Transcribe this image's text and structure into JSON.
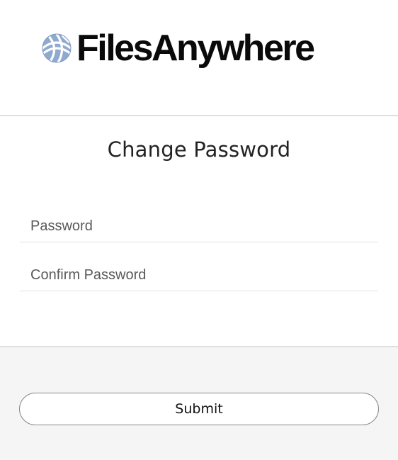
{
  "brand": {
    "name": "FilesAnywhere",
    "logo_icon": "globe-logo-icon"
  },
  "form": {
    "title": "Change Password",
    "password_placeholder": "Password",
    "confirm_placeholder": "Confirm Password",
    "password_value": "",
    "confirm_value": ""
  },
  "footer": {
    "submit_label": "Submit"
  },
  "colors": {
    "divider": "#dedede",
    "footer_bg": "#f5f5f5",
    "logo_icon_fill": "#8fa9cf"
  }
}
